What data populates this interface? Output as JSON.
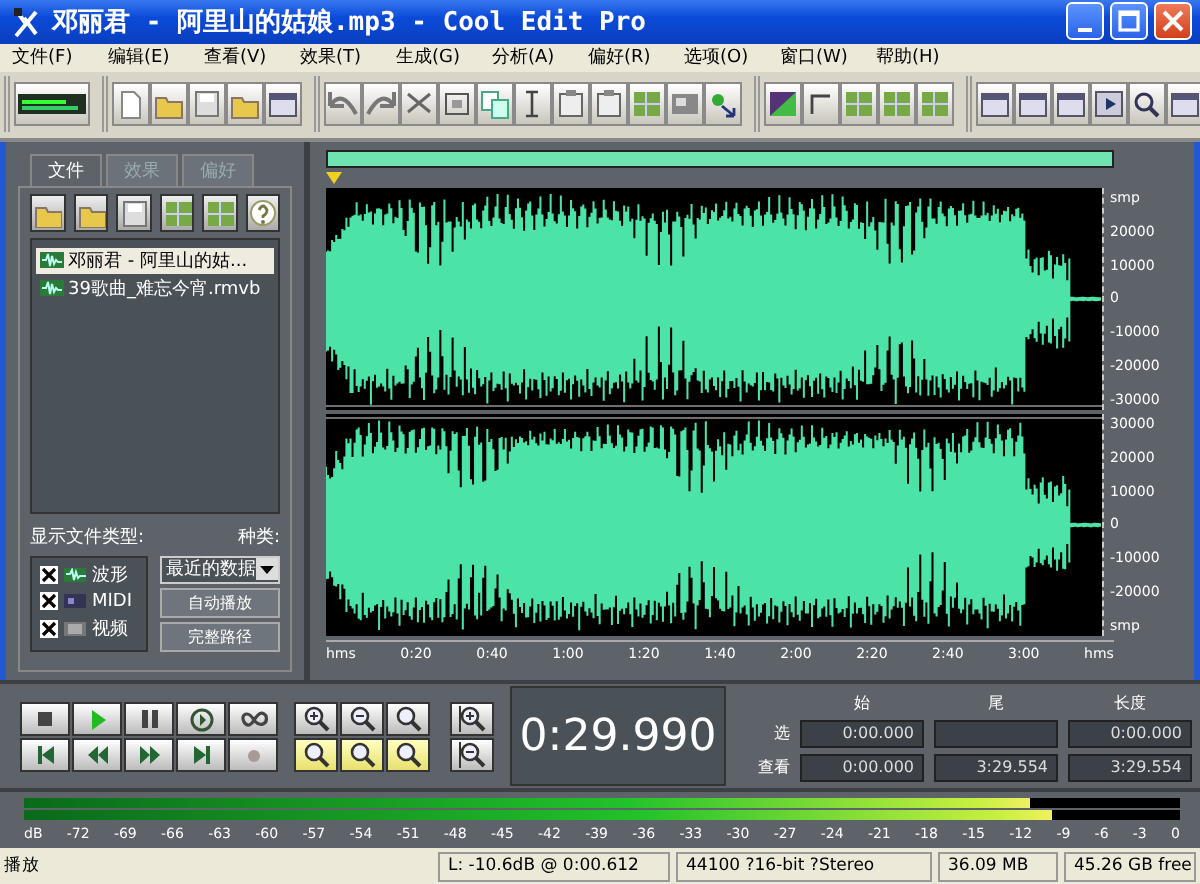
{
  "window": {
    "title": "邓丽君 - 阿里山的姑娘.mp3 - Cool Edit Pro"
  },
  "menu": [
    "文件(F)",
    "编辑(E)",
    "查看(V)",
    "效果(T)",
    "生成(G)",
    "分析(A)",
    "偏好(R)",
    "选项(O)",
    "窗口(W)",
    "帮助(H)"
  ],
  "organizer": {
    "tabs": [
      {
        "label": "文件",
        "selected": true
      },
      {
        "label": "效果",
        "selected": false
      },
      {
        "label": "偏好",
        "selected": false
      }
    ],
    "files": [
      {
        "name": "邓丽君 - 阿里山的姑...",
        "selected": true
      },
      {
        "name": "39歌曲_难忘今宵.rmvb",
        "selected": false
      }
    ],
    "file_types_label": "显示文件类型:",
    "file_types": [
      {
        "label": "波形",
        "checked": true
      },
      {
        "label": "MIDI",
        "checked": true
      },
      {
        "label": "视频",
        "checked": true
      }
    ],
    "sort_label": "种类:",
    "sort_value": "最近的数据",
    "buttons": [
      "自动播放",
      "完整路径"
    ]
  },
  "waveform": {
    "time_ruler": [
      "hms",
      "0:20",
      "0:40",
      "1:00",
      "1:20",
      "1:40",
      "2:00",
      "2:20",
      "2:40",
      "3:00",
      "hms"
    ],
    "channels": [
      {
        "scale": [
          "smp",
          "20000",
          "10000",
          "0",
          "-10000",
          "-20000",
          "-30000"
        ]
      },
      {
        "scale": [
          "30000",
          "20000",
          "10000",
          "0",
          "-10000",
          "-20000",
          "smp"
        ]
      }
    ]
  },
  "time_display": "0:29.990",
  "selection": {
    "headers": [
      "始",
      "尾",
      "长度"
    ],
    "rows": [
      {
        "label": "选",
        "begin": "0:00.000",
        "length": "0:00.000"
      },
      {
        "label": "查看",
        "begin": "0:00.000",
        "end": "3:29.554",
        "length": "3:29.554"
      }
    ]
  },
  "meter": {
    "channels": [
      {
        "level": 0.87
      },
      {
        "level": 0.89
      }
    ],
    "scale": [
      "dB",
      "-72",
      "-69",
      "-66",
      "-63",
      "-60",
      "-57",
      "-54",
      "-51",
      "-48",
      "-45",
      "-42",
      "-39",
      "-36",
      "-33",
      "-30",
      "-27",
      "-24",
      "-21",
      "-18",
      "-15",
      "-12",
      "-9",
      "-6",
      "-3",
      "0"
    ]
  },
  "status_bar": {
    "mode": "播放",
    "cells": [
      "L: -10.6dB @ 0:00.612",
      "44100 ?16-bit ?Stereo",
      "36.09 MB",
      "45.26 GB free"
    ]
  }
}
